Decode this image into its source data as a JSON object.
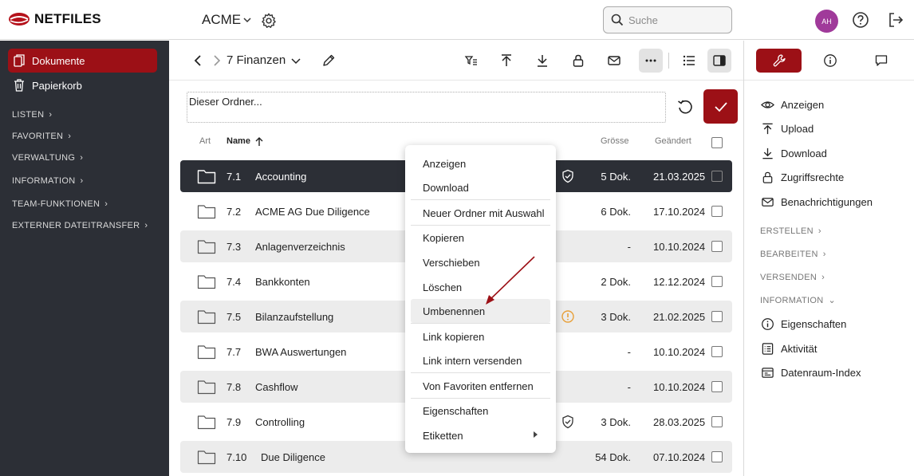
{
  "header": {
    "logo_text": "NETFILES",
    "org_name": "ACME",
    "search_placeholder": "Suche",
    "avatar_initials": "AH"
  },
  "sidebar": {
    "items": [
      {
        "label": "Dokumente",
        "icon": "documents-icon",
        "active": true
      },
      {
        "label": "Papierkorb",
        "icon": "trash-icon",
        "active": false
      }
    ],
    "groups": [
      "LISTEN",
      "FAVORITEN",
      "VERWALTUNG",
      "INFORMATION",
      "TEAM-FUNKTIONEN",
      "EXTERNER DATEITRANSFER"
    ]
  },
  "toolbar": {
    "folder_name": "7 Finanzen"
  },
  "description": {
    "value": "Dieser Ordner..."
  },
  "table": {
    "columns": {
      "type": "Art",
      "name": "Name",
      "size": "Grösse",
      "changed": "Geändert"
    },
    "rows": [
      {
        "num": "7.1",
        "name": "Accounting",
        "size": "5 Dok.",
        "date": "21.03.2025",
        "selected": true,
        "flag": "shield-icon"
      },
      {
        "num": "7.2",
        "name": "ACME AG Due Diligence",
        "size": "6 Dok.",
        "date": "17.10.2024"
      },
      {
        "num": "7.3",
        "name": "Anlagenverzeichnis",
        "size": "-",
        "date": "10.10.2024"
      },
      {
        "num": "7.4",
        "name": "Bankkonten",
        "size": "2 Dok.",
        "date": "12.12.2024"
      },
      {
        "num": "7.5",
        "name": "Bilanzaufstellung",
        "size": "3 Dok.",
        "date": "21.02.2025",
        "flag": "warning-icon"
      },
      {
        "num": "7.7",
        "name": "BWA Auswertungen",
        "size": "-",
        "date": "10.10.2024"
      },
      {
        "num": "7.8",
        "name": "Cashflow",
        "size": "-",
        "date": "10.10.2024"
      },
      {
        "num": "7.9",
        "name": "Controlling",
        "size": "3 Dok.",
        "date": "28.03.2025",
        "flag": "shield-icon"
      },
      {
        "num": "7.10",
        "name": "Due Diligence",
        "size": "54 Dok.",
        "date": "07.10.2024"
      }
    ]
  },
  "context_menu": {
    "items": [
      "Anzeigen",
      "Download",
      "Neuer Ordner mit Auswahl",
      "Kopieren",
      "Verschieben",
      "Löschen",
      "Umbenennen",
      "Link kopieren",
      "Link intern versenden",
      "Von Favoriten entfernen",
      "Eigenschaften",
      "Etiketten"
    ],
    "hovered": "Umbenennen"
  },
  "right_panel": {
    "actions": [
      "Anzeigen",
      "Upload",
      "Download",
      "Zugriffsrechte",
      "Benachrichtigungen"
    ],
    "groups": [
      "ERSTELLEN",
      "BEARBEITEN",
      "VERSENDEN",
      "INFORMATION"
    ],
    "info_items": [
      "Eigenschaften",
      "Aktivität",
      "Datenraum-Index"
    ]
  },
  "colors": {
    "accent": "#9c1016",
    "sidebar_bg": "#2c2f36",
    "avatar": "#a03a9a",
    "warning": "#e8a03a"
  }
}
